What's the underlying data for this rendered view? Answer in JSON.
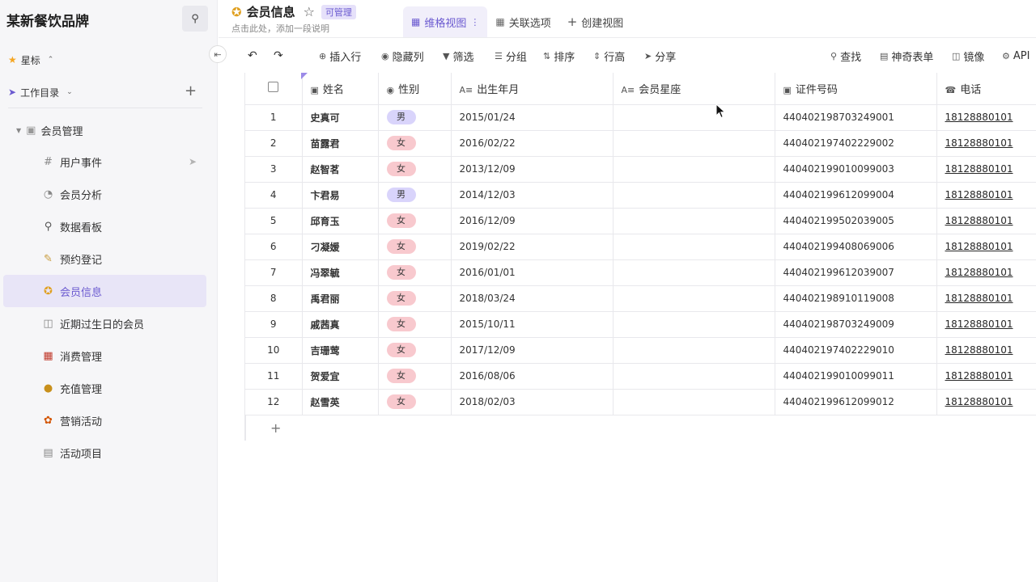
{
  "sidebar": {
    "brand": "某新餐饮品牌",
    "starred_label": "星标",
    "workspace_label": "工作目录",
    "folder_label": "会员管理",
    "items": [
      {
        "label": "用户事件",
        "icon": "hash-icon"
      },
      {
        "label": "会员分析",
        "icon": "pie-chart-icon"
      },
      {
        "label": "数据看板",
        "icon": "magnifier-icon"
      },
      {
        "label": "预约登记",
        "icon": "memo-icon"
      },
      {
        "label": "会员信息",
        "icon": "medal-icon"
      },
      {
        "label": "近期过生日的会员",
        "icon": "mirror-icon"
      },
      {
        "label": "消费管理",
        "icon": "calendar-icon"
      },
      {
        "label": "充值管理",
        "icon": "money-bag-icon"
      },
      {
        "label": "营销活动",
        "icon": "party-popper-icon"
      },
      {
        "label": "活动项目",
        "icon": "spiral-notepad-icon"
      }
    ]
  },
  "header": {
    "title": "会员信息",
    "badge": "可管理",
    "description": "点击此处，添加一段说明",
    "tabs": [
      {
        "label": "维格视图"
      },
      {
        "label": "关联选项"
      },
      {
        "label": "创建视图"
      }
    ]
  },
  "toolbar": {
    "insert_row": "插入行",
    "hide_columns": "隐藏列",
    "filter": "筛选",
    "group": "分组",
    "sort": "排序",
    "row_height": "行高",
    "share": "分享",
    "find": "查找",
    "magic_form": "神奇表单",
    "mirror": "镜像",
    "api": "API"
  },
  "table": {
    "columns": [
      "姓名",
      "性别",
      "出生年月",
      "会员星座",
      "证件号码",
      "电话"
    ],
    "rows": [
      {
        "no": "1",
        "name": "史真可",
        "gender": "男",
        "birth": "2015/01/24",
        "zodiac": "",
        "id": "440402198703249001",
        "phone": "18128880101"
      },
      {
        "no": "2",
        "name": "苗露君",
        "gender": "女",
        "birth": "2016/02/22",
        "zodiac": "",
        "id": "440402197402229002",
        "phone": "18128880101"
      },
      {
        "no": "3",
        "name": "赵智茗",
        "gender": "女",
        "birth": "2013/12/09",
        "zodiac": "",
        "id": "440402199010099003",
        "phone": "18128880101"
      },
      {
        "no": "4",
        "name": "卞君易",
        "gender": "男",
        "birth": "2014/12/03",
        "zodiac": "",
        "id": "440402199612099004",
        "phone": "18128880101"
      },
      {
        "no": "5",
        "name": "邱育玉",
        "gender": "女",
        "birth": "2016/12/09",
        "zodiac": "",
        "id": "440402199502039005",
        "phone": "18128880101"
      },
      {
        "no": "6",
        "name": "刁凝媛",
        "gender": "女",
        "birth": "2019/02/22",
        "zodiac": "",
        "id": "440402199408069006",
        "phone": "18128880101"
      },
      {
        "no": "7",
        "name": "冯翠毓",
        "gender": "女",
        "birth": "2016/01/01",
        "zodiac": "",
        "id": "440402199612039007",
        "phone": "18128880101"
      },
      {
        "no": "8",
        "name": "禹君丽",
        "gender": "女",
        "birth": "2018/03/24",
        "zodiac": "",
        "id": "440402198910119008",
        "phone": "18128880101"
      },
      {
        "no": "9",
        "name": "戚茜真",
        "gender": "女",
        "birth": "2015/10/11",
        "zodiac": "",
        "id": "440402198703249009",
        "phone": "18128880101"
      },
      {
        "no": "10",
        "name": "吉珊莺",
        "gender": "女",
        "birth": "2017/12/09",
        "zodiac": "",
        "id": "440402197402229010",
        "phone": "18128880101"
      },
      {
        "no": "11",
        "name": "贺爱宜",
        "gender": "女",
        "birth": "2016/08/06",
        "zodiac": "",
        "id": "440402199010099011",
        "phone": "18128880101"
      },
      {
        "no": "12",
        "name": "赵雪英",
        "gender": "女",
        "birth": "2018/02/03",
        "zodiac": "",
        "id": "440402199612099012",
        "phone": "18128880101"
      }
    ]
  },
  "colors": {
    "accent": "#6b5ad0",
    "male_tag": "#d9d4fb",
    "female_tag": "#f8c9ce",
    "sidebar_bg": "#f6f6f8"
  }
}
